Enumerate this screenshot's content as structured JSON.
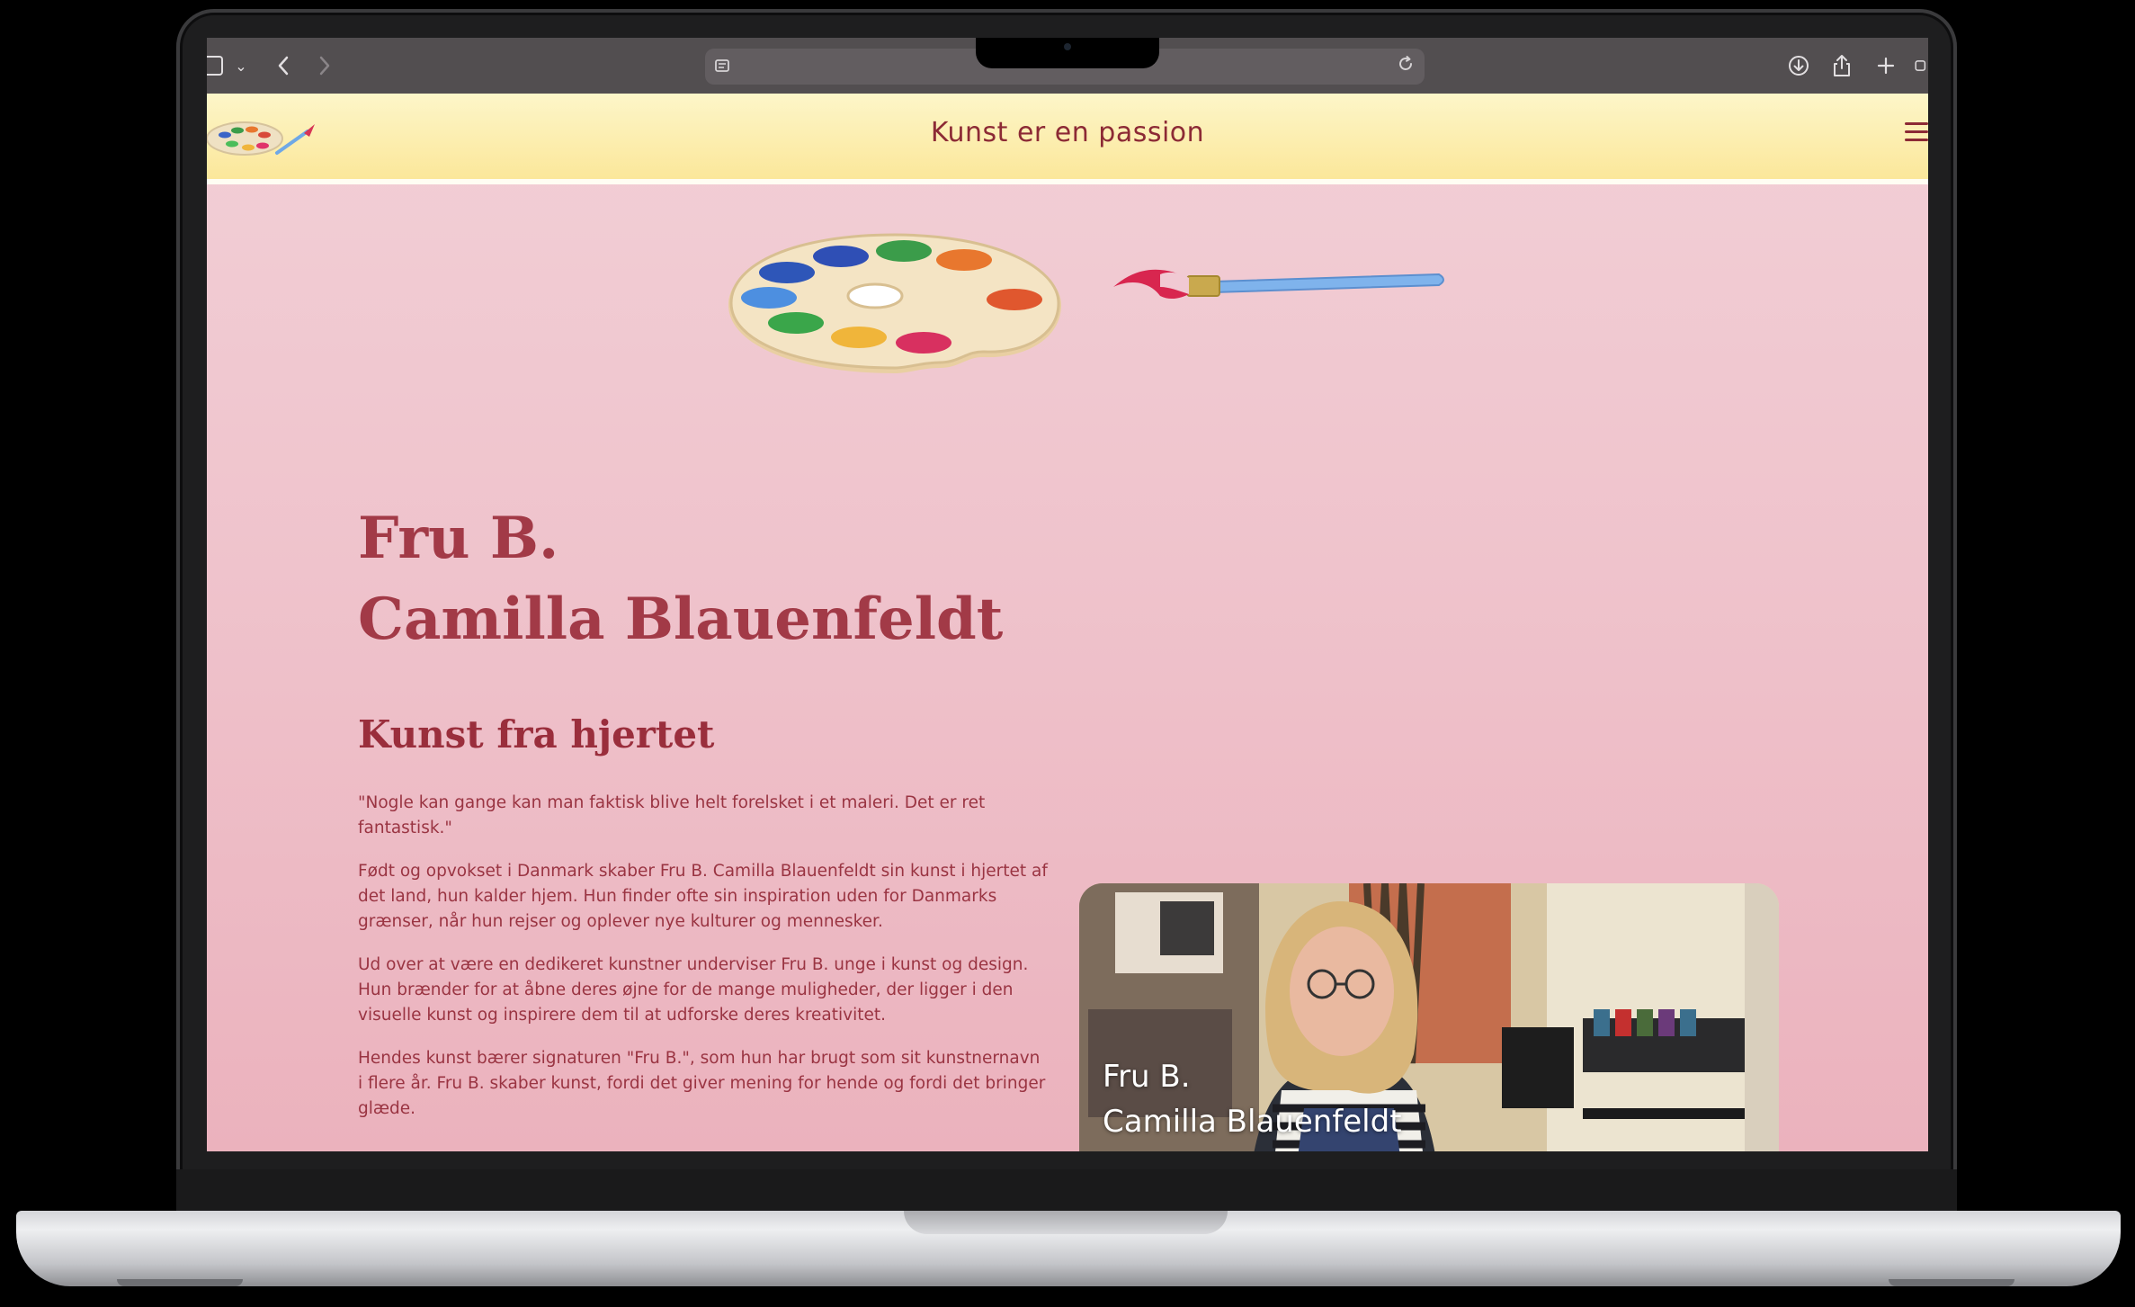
{
  "browser": {
    "toolbar_icons": [
      "sidebar-icon",
      "chevron-down-icon",
      "back-icon",
      "forward-icon",
      "page-icon",
      "reload-icon",
      "download-icon",
      "share-icon",
      "new-tab-icon",
      "tabs-icon"
    ]
  },
  "header": {
    "title": "Kunst er en passion",
    "colors": {
      "background": "#fbe79a",
      "title": "#8c2a35"
    }
  },
  "main": {
    "name_line1": "Fru B.",
    "name_line2": "Camilla Blauenfeldt",
    "subtitle": "Kunst fra hjertet",
    "paragraphs": [
      "\"Nogle kan gange kan man faktisk blive helt forelsket i et maleri. Det er ret fantastisk.\"",
      "Født og opvokset i Danmark skaber Fru B. Camilla Blauenfeldt sin kunst i hjertet af det land, hun kalder hjem. Hun finder ofte sin inspiration uden for Danmarks grænser, når hun rejser og oplever nye kulturer og mennesker.",
      "Ud over at være en dedikeret kunstner underviser Fru B. unge i kunst og design. Hun brænder for at åbne deres øjne for de mange muligheder, der ligger i den visuelle kunst og inspirere dem til at udforske deres kreativitet.",
      "Hendes kunst bærer signaturen \"Fru B.\", som hun har brugt som sit kunstnernavn i flere år. Fru B. skaber kunst, fordi det giver mening for hende og fordi det bringer glæde."
    ],
    "video": {
      "caption_line1": "Fru B.",
      "caption_line2": "Camilla Blauenfeldt"
    },
    "colors": {
      "page_background": "#efc3cc",
      "heading": "#a23a47",
      "text": "#9a3442"
    }
  }
}
